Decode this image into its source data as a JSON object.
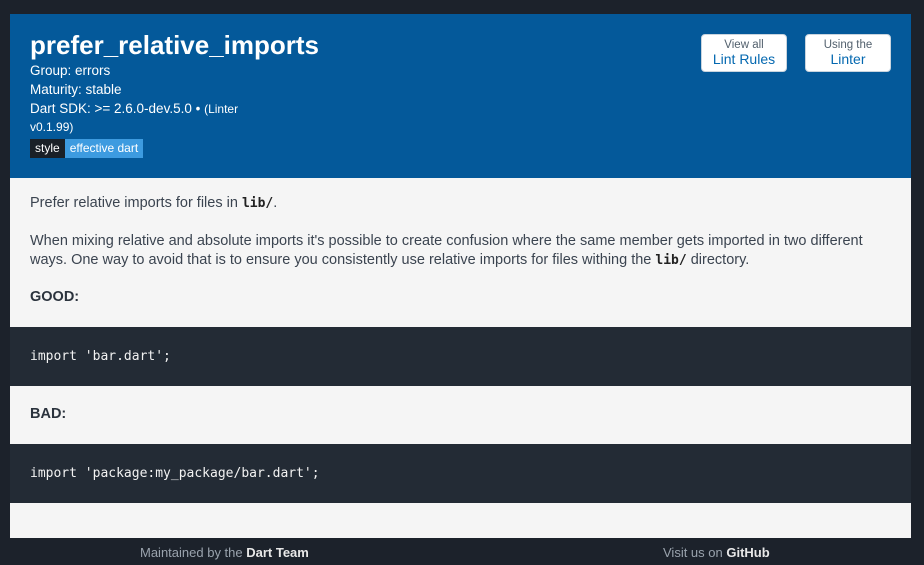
{
  "rule": {
    "title": "prefer_relative_imports",
    "group": "Group: errors",
    "maturity": "Maturity: stable",
    "sdk": "Dart SDK: >= 2.6.0-dev.5.0 • ",
    "linter_open": "(Linter",
    "linter_version": "v0.1.99)",
    "tags": [
      "style",
      "effective dart"
    ]
  },
  "buttons": {
    "view_all_small": "View all",
    "view_all_big": "Lint Rules",
    "using_small": "Using the",
    "using_big": "Linter"
  },
  "content": {
    "p1_before": "Prefer relative imports for files in ",
    "p1_code": "lib/",
    "p1_after": ".",
    "p2_before": "When mixing relative and absolute imports it's possible to create confusion where the same member gets imported in two different ways. One way to avoid that is to ensure you consistently use relative imports for files withing the ",
    "p2_code": "lib/",
    "p2_after": " directory.",
    "good_label": "GOOD:",
    "good_code": "import 'bar.dart';",
    "bad_label": "BAD:",
    "bad_code": "import 'package:my_package/bar.dart';"
  },
  "footer": {
    "left_text": "Maintained by the ",
    "left_bold": "Dart Team",
    "right_text": "Visit us on ",
    "right_bold": "GitHub"
  },
  "colors": {
    "header_bg": "#04599a",
    "code_bg": "#232b35",
    "page_bg": "#1c222b",
    "tag_style": "#1a2027",
    "tag_effective": "#3d9be0"
  }
}
